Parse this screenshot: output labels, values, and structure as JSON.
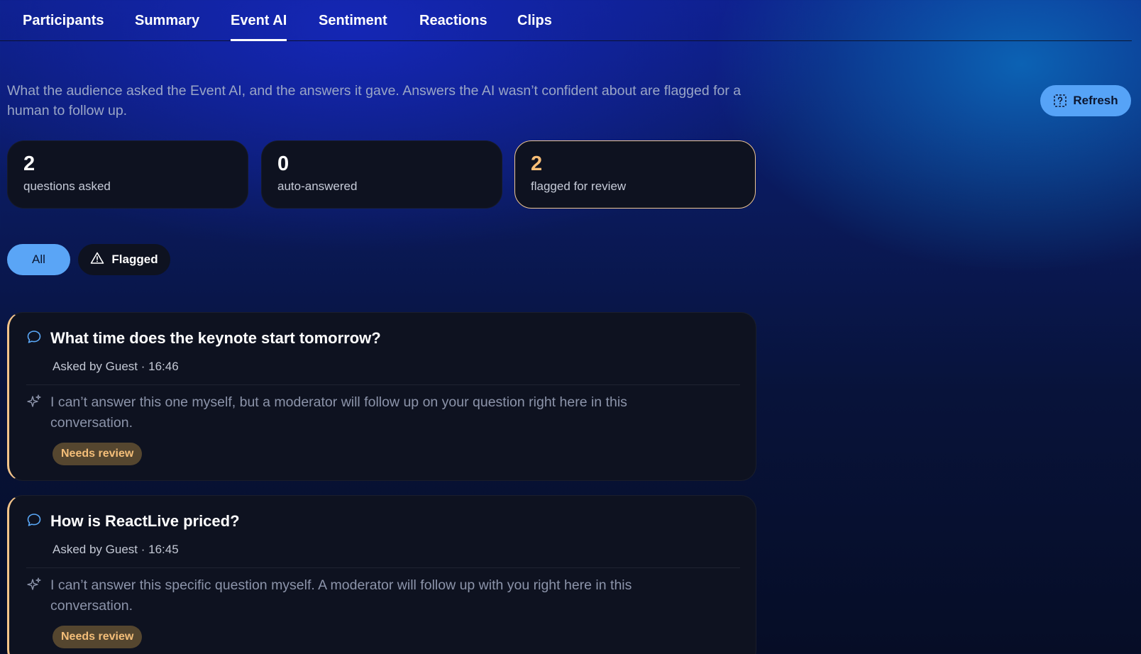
{
  "tabs": [
    {
      "label": "Participants"
    },
    {
      "label": "Summary"
    },
    {
      "label": "Event AI",
      "active": true
    },
    {
      "label": "Sentiment"
    },
    {
      "label": "Reactions"
    },
    {
      "label": "Clips"
    }
  ],
  "intro": "What the audience asked the Event AI, and the answers it gave. Answers the AI wasn’t confident about are flagged for a human to follow up.",
  "refresh_label": "Refresh",
  "stats": [
    {
      "value": "2",
      "label": "questions asked"
    },
    {
      "value": "0",
      "label": "auto-answered"
    },
    {
      "value": "2",
      "label": "flagged for review"
    }
  ],
  "filters": {
    "all": "All",
    "flagged": "Flagged",
    "selected": "All"
  },
  "questions": [
    {
      "question": "What time does the keynote start tomorrow?",
      "meta": "Asked by Guest · 16:46",
      "answer": "I can’t answer this one myself, but a moderator will follow up on your question right here in this conversation.",
      "badge": "Needs review"
    },
    {
      "question": "How is ReactLive priced?",
      "meta": "Asked by Guest · 16:45",
      "answer": "I can’t answer this specific question myself. A moderator will follow up with you right here in this conversation.",
      "badge": "Needs review"
    }
  ],
  "colors": {
    "accent": "#56a3f7",
    "flag": "#f6bd77",
    "card": "#0e1220",
    "badge_bg": "#55462f"
  },
  "icons": {
    "refresh": "question-box-icon",
    "flagged": "warning-triangle-icon",
    "question": "chat-bubble-icon",
    "answer": "sparkle-icon"
  }
}
